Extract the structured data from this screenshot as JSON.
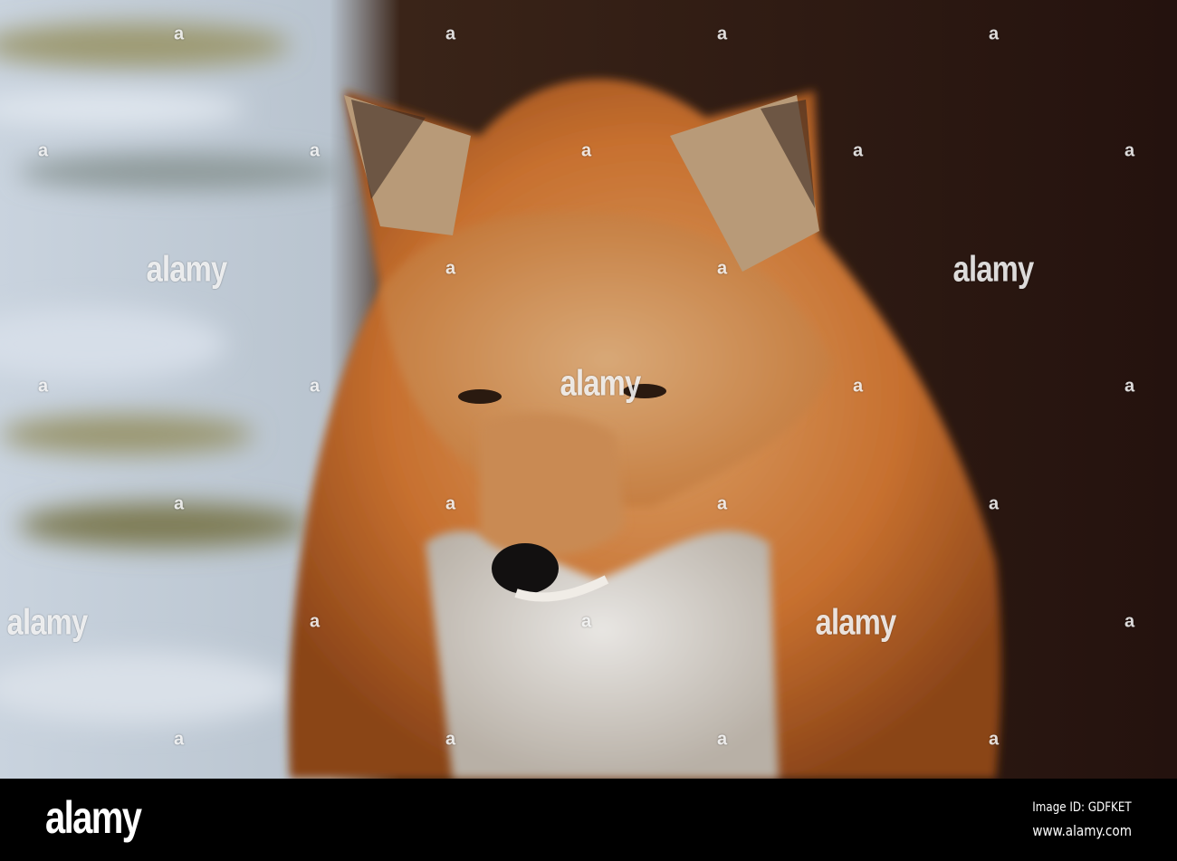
{
  "watermark": {
    "brand": "alamy",
    "mark": "a"
  },
  "footer": {
    "logo": "alamy",
    "image_id": "Image ID: GDFKET",
    "site": "www.alamy.com"
  }
}
